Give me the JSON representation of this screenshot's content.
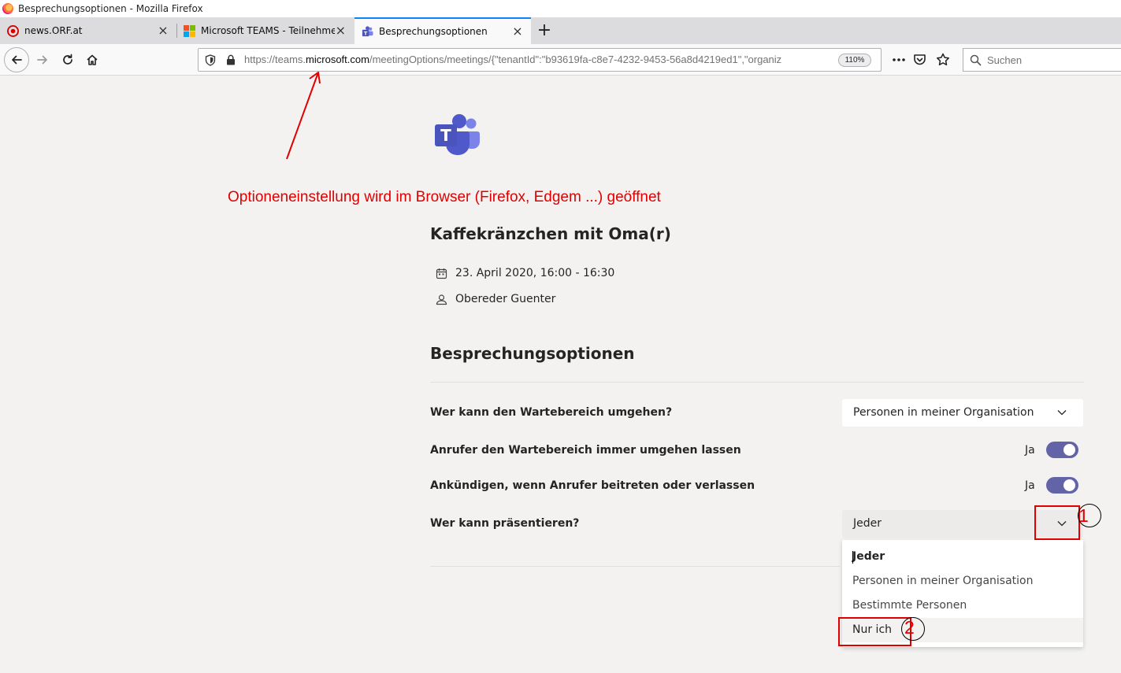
{
  "window": {
    "title": "Besprechungsoptionen - Mozilla Firefox"
  },
  "tabs": [
    {
      "label": "news.ORF.at",
      "close": "×"
    },
    {
      "label": "Microsoft TEAMS - Teilnehmer",
      "close": "×"
    },
    {
      "label": "Besprechungsoptionen",
      "close": "×"
    }
  ],
  "new_tab_label": "+",
  "urlbar": {
    "prefix": "https://teams.",
    "domain": "microsoft.com",
    "rest": "/meetingOptions/meetings/{\"tenantId\":\"b93619fa-c8e7-4232-9453-56a8d4219ed1\",\"organiz",
    "zoom": "110%"
  },
  "search": {
    "placeholder": "Suchen"
  },
  "annotation": {
    "text": "Optioneneinstellung wird im Browser (Firefox, Edgem ...) geöffnet",
    "marker1": "1",
    "marker2": "2",
    "color": "#e00000"
  },
  "meeting": {
    "title": "Kaffekränzchen mit Oma(r)",
    "datetime": "23. April 2020, 16:00 - 16:30",
    "organizer": "Obereder Guenter"
  },
  "options": {
    "section_title": "Besprechungsoptionen",
    "lobby_bypass": {
      "label": "Wer kann den Wartebereich umgehen?",
      "value": "Personen in meiner Organisation"
    },
    "callers_bypass": {
      "label": "Anrufer den Wartebereich immer umgehen lassen",
      "toggle_label": "Ja",
      "on": true
    },
    "announce": {
      "label": "Ankündigen, wenn Anrufer beitreten oder verlassen",
      "toggle_label": "Ja",
      "on": true
    },
    "presenters": {
      "label": "Wer kann präsentieren?",
      "value": "Jeder",
      "menu": [
        "Jeder",
        "Personen in meiner Organisation",
        "Bestimmte Personen",
        "Nur ich"
      ]
    }
  },
  "colors": {
    "accent": "#6264a7",
    "firefox_blue": "#0a84ff"
  }
}
